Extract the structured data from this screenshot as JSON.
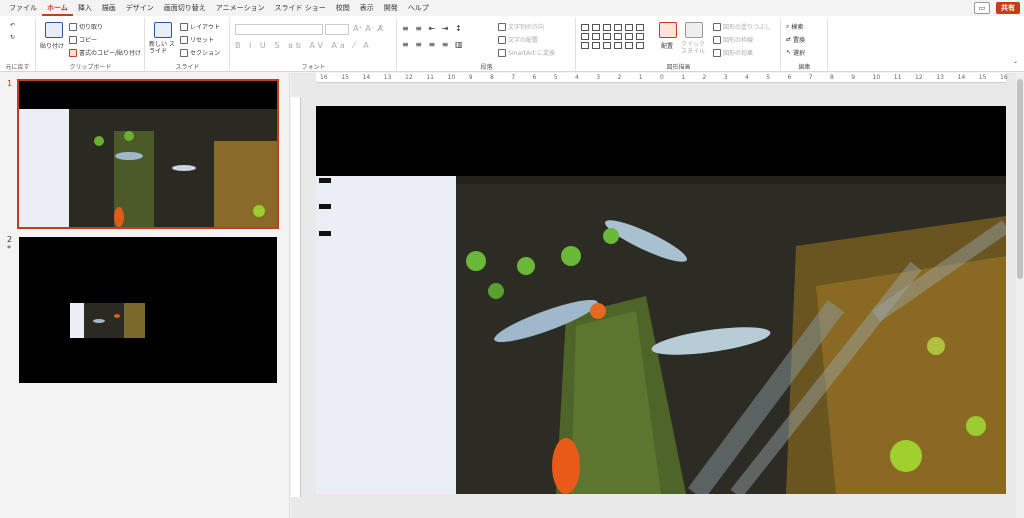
{
  "menu": {
    "tabs": [
      "ファイル",
      "ホーム",
      "挿入",
      "描画",
      "デザイン",
      "画面切り替え",
      "アニメーション",
      "スライド ショー",
      "校閲",
      "表示",
      "開発",
      "ヘルプ"
    ],
    "active_index": 1,
    "share_label": "共有"
  },
  "ribbon": {
    "undo": {
      "label": "元に戻す"
    },
    "clipboard": {
      "label": "クリップボード",
      "paste": "貼り付け",
      "cut": "切り取り",
      "copy": "コピー",
      "format_painter": "書式のコピー/貼り付け"
    },
    "slides": {
      "label": "スライド",
      "new_slide": "新しい スライド",
      "layout": "レイアウト",
      "reset": "リセット",
      "section": "セクション"
    },
    "font": {
      "label": "フォント"
    },
    "paragraph": {
      "label": "段落",
      "text_direction": "文字列の方向",
      "align_text": "文字の配置",
      "smartart": "SmartArt に変換"
    },
    "drawing": {
      "label": "図形描画",
      "arrange": "配置",
      "quick_styles": "クイック スタイル",
      "shape_fill": "図形の塗りつぶし",
      "shape_outline": "図形の枠線",
      "shape_effects": "図形の効果"
    },
    "editing": {
      "label": "編集",
      "find": "検索",
      "replace": "置換",
      "select": "選択"
    }
  },
  "thumbnails": [
    {
      "number": "1",
      "selected": true
    },
    {
      "number": "2",
      "star": "*",
      "selected": false
    }
  ],
  "ruler": {
    "ticks": [
      "16",
      "15",
      "14",
      "13",
      "12",
      "11",
      "10",
      "9",
      "8",
      "7",
      "6",
      "5",
      "4",
      "3",
      "2",
      "1",
      "0",
      "1",
      "2",
      "3",
      "4",
      "5",
      "6",
      "7",
      "8",
      "9",
      "10",
      "11",
      "12",
      "13",
      "14",
      "15",
      "16"
    ]
  },
  "colors": {
    "accent": "#c43e1c",
    "ribbon_bg": "#ffffff",
    "app_bg": "#f3f3f3"
  }
}
